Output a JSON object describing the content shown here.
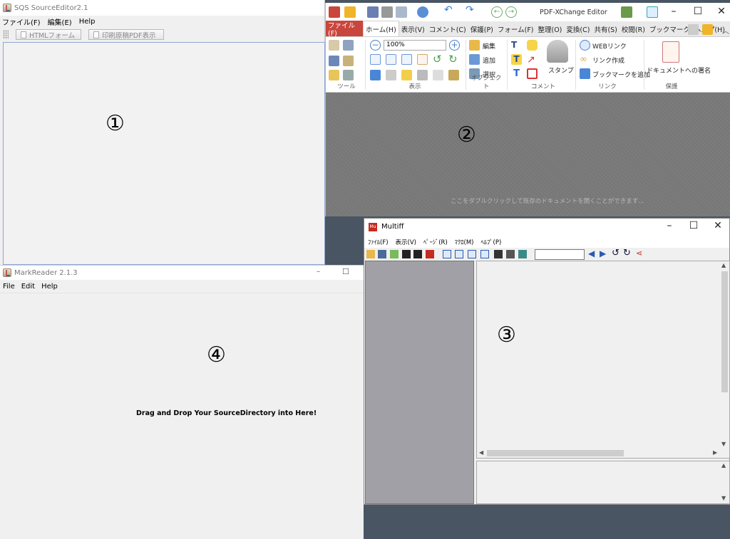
{
  "sqs_editor": {
    "title": "SQS SourceEditor2.1",
    "menu": [
      "ファイル(F)",
      "編集(E)",
      "Help"
    ],
    "toolbar": {
      "html_form": "HTMLフォーム",
      "print_pdf": "印刷原稿PDF表示"
    },
    "marker": "①"
  },
  "pdf_xchange": {
    "title": "PDF-XChange Editor",
    "tabs": [
      "ファイル(F)",
      "ホーム(H)",
      "表示(V)",
      "コメント(C)",
      "保護(P)",
      "フォーム(F)",
      "整理(O)",
      "変換(C)",
      "共有(S)",
      "校閲(R)",
      "ブックマーク",
      "ヘルプ(H)"
    ],
    "active_tab": "ホーム(H)",
    "ribbon": {
      "zoom_value": "100%",
      "edit": "編集",
      "add": "追加",
      "select": "選択",
      "stamp": "スタンプ",
      "web_link": "WEBリンク",
      "create_link": "リンク作成",
      "add_bookmark": "ブックマークを追加",
      "sign_document": "ドキュメントへの署名",
      "groups": [
        "ツール",
        "表示",
        "オブジェクト",
        "コメント",
        "リンク",
        "保護"
      ]
    },
    "hint": "ここをダブルクリックして既存のドキュメントを開くことができます...",
    "marker": "②"
  },
  "multiff": {
    "title": "Multiff",
    "menu": [
      "ﾌｧｲﾙ(F)",
      "表示(V)",
      "ﾍﾟｰｼﾞ(R)",
      "ﾏｸﾛ(M)",
      "ﾍﾙﾌﾟ(P)"
    ],
    "page_input": "",
    "marker": "③"
  },
  "markreader": {
    "title": "MarkReader 2.1.3",
    "menu": [
      "File",
      "Edit",
      "Help"
    ],
    "drop_message": "Drag and Drop Your SourceDirectory into Here!",
    "marker": "④"
  },
  "colors": {
    "pdf_file_tab": "#c9463d",
    "multiff_left_pane": "#a0a0a6",
    "desktop": "#4a5563"
  }
}
